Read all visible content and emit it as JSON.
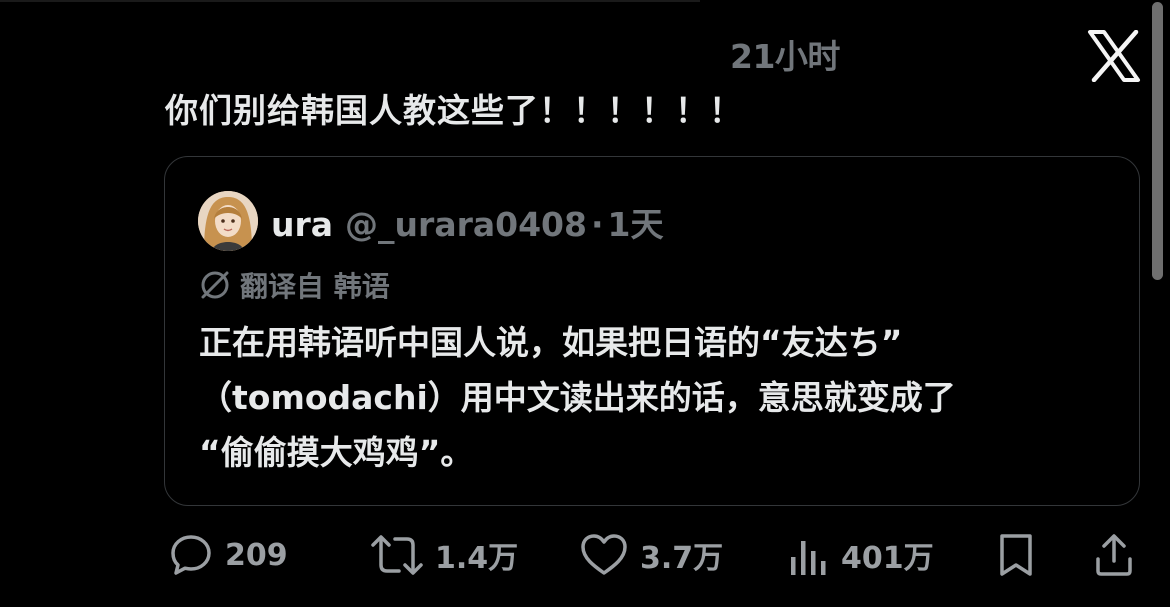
{
  "header": {
    "timestamp": "21小时",
    "logo_icon": "x-logo-icon"
  },
  "tweet": {
    "text": "你们别给韩国人教这些了！！！！！！"
  },
  "quote": {
    "author_name": "ura",
    "author_handle": "@_urara0408",
    "separator": "·",
    "age": "1天",
    "translated_label": "翻译自 韩语",
    "body_lines": [
      "正在用韩语听中国人说，如果把日语的“友达ち”",
      "（tomodachi）用中文读出来的话，意思就变成了",
      "“偷偷摸大鸡鸡”。"
    ]
  },
  "actions": {
    "reply": {
      "icon": "reply-icon",
      "count": "209"
    },
    "retweet": {
      "icon": "retweet-icon",
      "count": "1.4万"
    },
    "like": {
      "icon": "heart-icon",
      "count": "3.7万"
    },
    "views": {
      "icon": "views-icon",
      "count": "401万"
    },
    "bookmark": {
      "icon": "bookmark-icon"
    },
    "share": {
      "icon": "share-icon"
    }
  }
}
